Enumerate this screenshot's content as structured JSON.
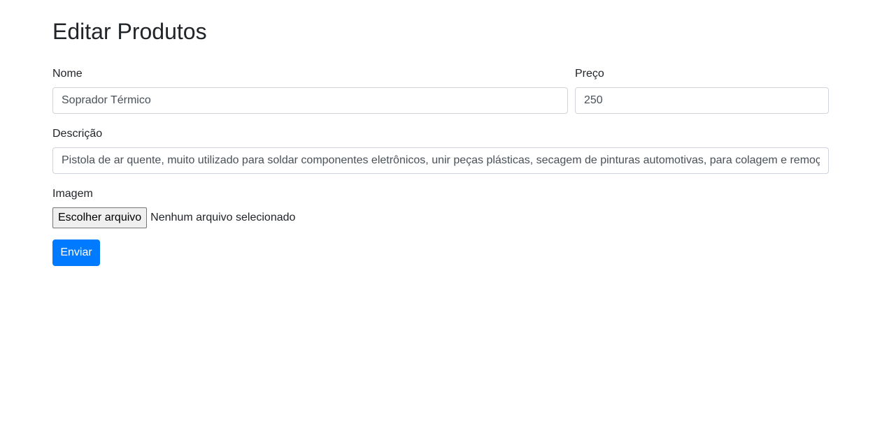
{
  "page": {
    "title": "Editar Produtos"
  },
  "form": {
    "name": {
      "label": "Nome",
      "value": "Soprador Térmico"
    },
    "price": {
      "label": "Preço",
      "value": "250"
    },
    "description": {
      "label": "Descrição",
      "value": "Pistola de ar quente, muito utilizado para soldar componentes eletrônicos, unir peças plásticas, secagem de pinturas automotivas, para colagem e remoção"
    },
    "image": {
      "label": "Imagem",
      "button_label": "Escolher arquivo",
      "status": "Nenhum arquivo selecionado"
    },
    "submit_label": "Enviar"
  },
  "colors": {
    "primary": "#007bff",
    "text": "#212529",
    "input_text": "#495057",
    "input_border": "#ced4da"
  }
}
